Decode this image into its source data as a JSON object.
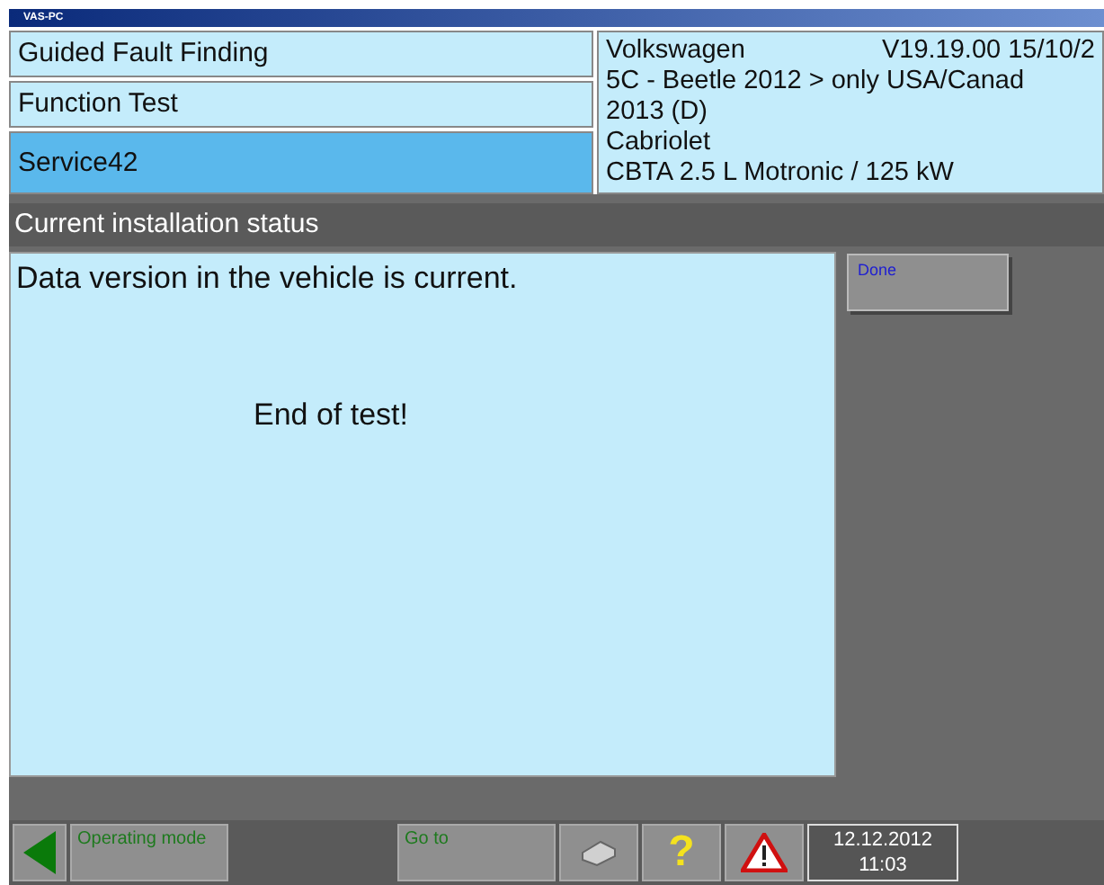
{
  "window": {
    "title": "VAS-PC"
  },
  "navigation": [
    {
      "label": "Guided Fault Finding",
      "selected": false
    },
    {
      "label": "Function Test",
      "selected": false
    },
    {
      "label": "Service42",
      "selected": true
    }
  ],
  "vehicle": {
    "lines": [
      "5C - Beetle 2012 > only USA/Canad",
      "2013 (D)",
      "Cabriolet",
      "CBTA 2.5 L Motronic / 125 kW"
    ],
    "brand": "Volkswagen",
    "version": "V19.19.00 15/10/2"
  },
  "section_title": "Current installation status",
  "message": "Data version in the vehicle is current.",
  "result": "End of test!",
  "side_buttons": [
    {
      "label": "Done"
    }
  ],
  "toolbar": {
    "mode_button": "Operating mode",
    "goto_button": "Go to",
    "help": "?",
    "date": "12.12.2012",
    "time": "11:03"
  }
}
